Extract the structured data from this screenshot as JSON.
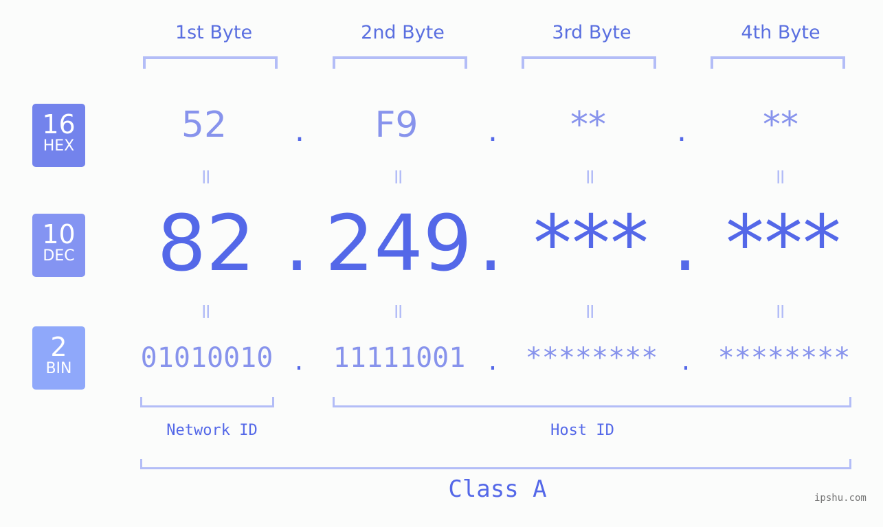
{
  "bytes": [
    {
      "label": "1st Byte",
      "hex": "52",
      "dec": "82",
      "bin": "01010010"
    },
    {
      "label": "2nd Byte",
      "hex": "F9",
      "dec": "249",
      "bin": "11111001"
    },
    {
      "label": "3rd Byte",
      "hex": "**",
      "dec": "***",
      "bin": "********"
    },
    {
      "label": "4th Byte",
      "hex": "**",
      "dec": "***",
      "bin": "********"
    }
  ],
  "separator": ".",
  "equals": "=",
  "badges": [
    {
      "num": "16",
      "label": "HEX",
      "color": "#7383ec"
    },
    {
      "num": "10",
      "label": "DEC",
      "color": "#8494f2"
    },
    {
      "num": "2",
      "label": "BIN",
      "color": "#8fa8fa"
    }
  ],
  "network_id_label": "Network ID",
  "host_id_label": "Host ID",
  "class_label": "Class A",
  "watermark": "ipshu.com"
}
